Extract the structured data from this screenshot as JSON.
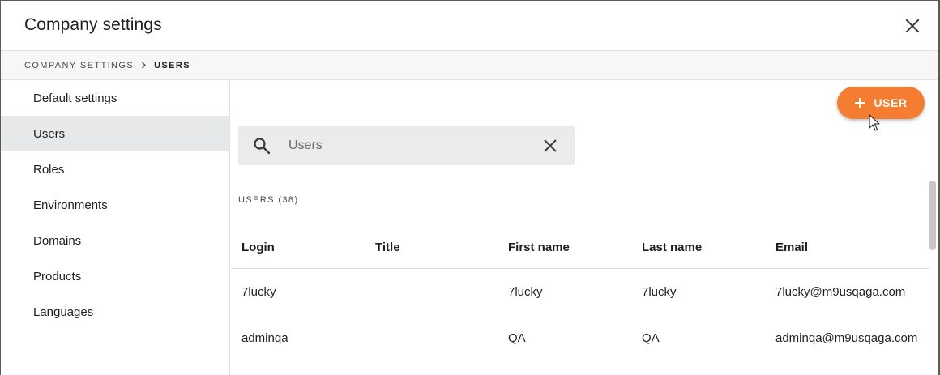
{
  "header": {
    "title": "Company settings"
  },
  "breadcrumb": {
    "items": [
      "COMPANY SETTINGS",
      "USERS"
    ]
  },
  "sidebar": {
    "items": [
      {
        "label": "Default settings",
        "active": false
      },
      {
        "label": "Users",
        "active": true
      },
      {
        "label": "Roles",
        "active": false
      },
      {
        "label": "Environments",
        "active": false
      },
      {
        "label": "Domains",
        "active": false
      },
      {
        "label": "Products",
        "active": false
      },
      {
        "label": "Languages",
        "active": false
      }
    ]
  },
  "toolbar": {
    "add_user_label": "USER"
  },
  "search": {
    "placeholder": "Users",
    "value": ""
  },
  "users": {
    "count_label": "USERS (38)",
    "columns": [
      "Login",
      "Title",
      "First name",
      "Last name",
      "Email"
    ],
    "rows": [
      [
        "7lucky",
        "",
        "7lucky",
        "7lucky",
        "7lucky@m9usqaga.com"
      ],
      [
        "adminqa",
        "",
        "QA",
        "QA",
        "adminqa@m9usqaga.com"
      ]
    ]
  },
  "colors": {
    "accent": "#f47d31",
    "active_item_bg": "#e6e8e9"
  },
  "icons": {
    "close": "close-icon",
    "search": "search-icon",
    "clear": "clear-icon",
    "add": "plus-icon"
  }
}
